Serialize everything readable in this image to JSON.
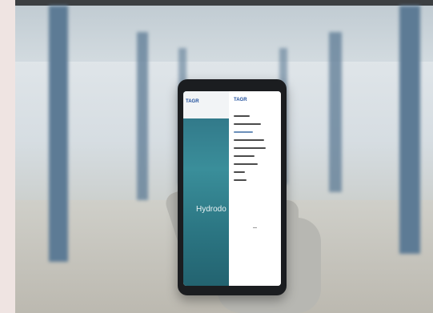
{
  "scene": {
    "description_tags": [
      "pier-underside",
      "hand-in-knit-glove",
      "smartphone"
    ],
    "colors": {
      "pillar": "#5d7b95",
      "sky": "#e6ebee",
      "phone_body": "#1b1d20",
      "teal_panel": "#2e6f82"
    }
  },
  "phone_screen": {
    "left_logo": "TAGR",
    "right_logo": "TAGR",
    "hero_text": "Hydrodo",
    "menu_items": [
      {
        "label": "",
        "type": "item"
      },
      {
        "label": "",
        "type": "item"
      },
      {
        "label": "",
        "type": "sub"
      },
      {
        "label": "",
        "type": "item"
      },
      {
        "label": "",
        "type": "item"
      },
      {
        "label": "",
        "type": "item"
      },
      {
        "label": "",
        "type": "item"
      },
      {
        "label": "",
        "type": "item"
      },
      {
        "label": "",
        "type": "item"
      }
    ]
  }
}
